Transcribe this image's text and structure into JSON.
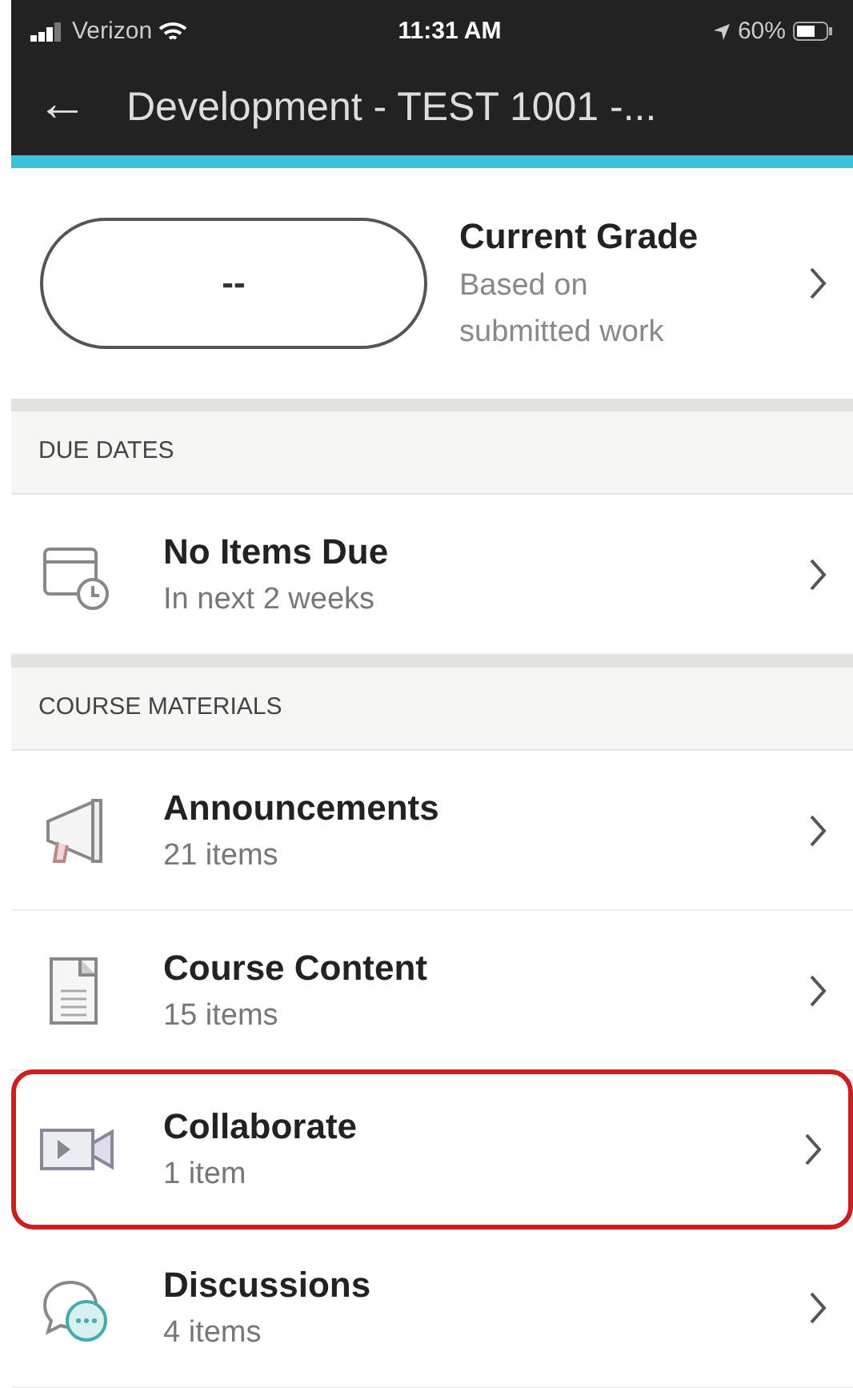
{
  "status_bar": {
    "carrier": "Verizon",
    "time": "11:31 AM",
    "battery": "60%"
  },
  "header": {
    "back": "←",
    "title": "Development - TEST 1001 -..."
  },
  "grade": {
    "value": "--",
    "title": "Current Grade",
    "subtitle": "Based on submitted work"
  },
  "sections": [
    {
      "title": "DUE DATES",
      "items": [
        {
          "kind": "calendar",
          "title": "No Items Due",
          "subtitle": "In next 2 weeks",
          "highlighted": false
        }
      ]
    },
    {
      "title": "COURSE MATERIALS",
      "items": [
        {
          "kind": "announcement",
          "title": "Announcements",
          "subtitle": "21 items",
          "highlighted": false
        },
        {
          "kind": "content",
          "title": "Course Content",
          "subtitle": "15 items",
          "highlighted": false
        },
        {
          "kind": "collaborate",
          "title": "Collaborate",
          "subtitle": "1 item",
          "highlighted": true
        },
        {
          "kind": "discussion",
          "title": "Discussions",
          "subtitle": "4 items",
          "highlighted": false
        }
      ]
    }
  ]
}
